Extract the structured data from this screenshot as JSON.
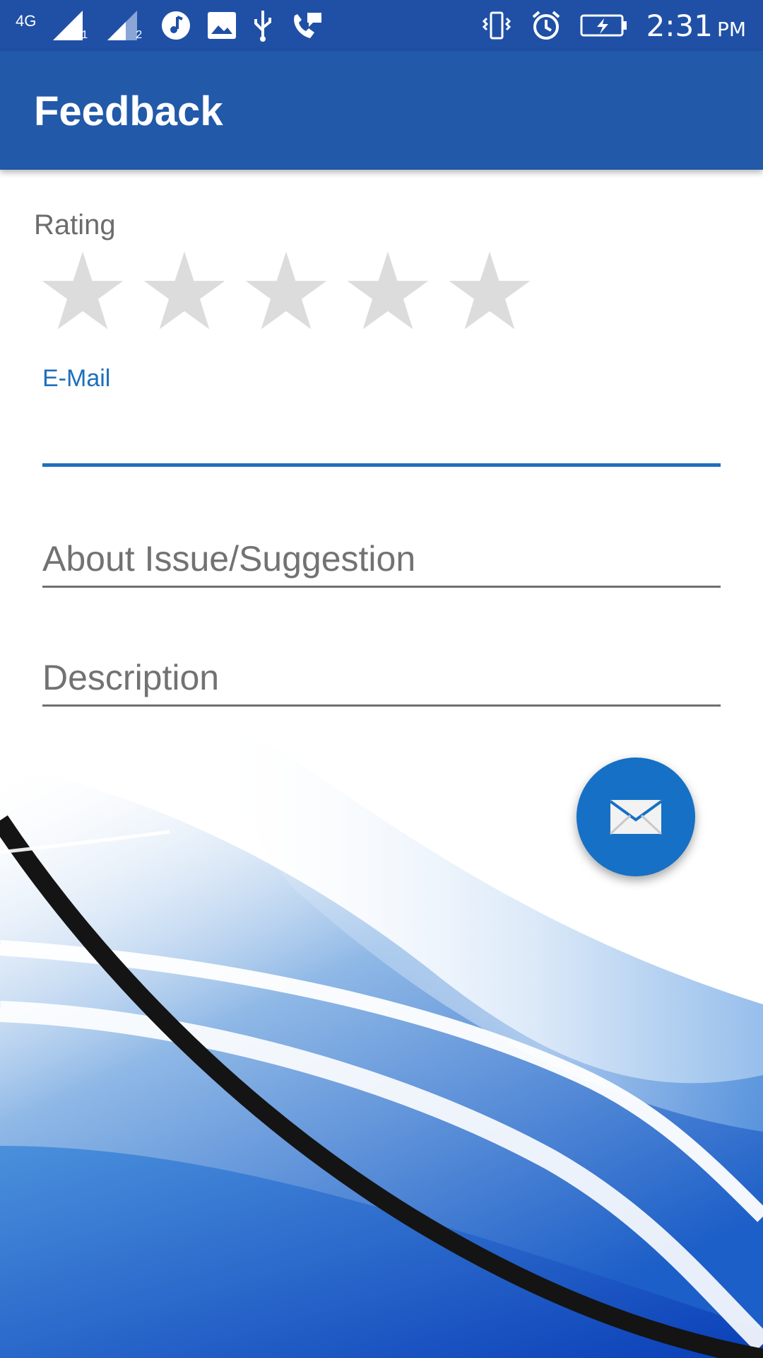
{
  "status_bar": {
    "network_type": "4G",
    "sim1_label": "1",
    "sim2_label": "2",
    "time": "2:31",
    "ampm": "PM",
    "icons": [
      "signal-icon",
      "music-icon",
      "image-icon",
      "usb-icon",
      "call-icon",
      "vibrate-icon",
      "alarm-icon",
      "battery-charging-icon"
    ]
  },
  "app_bar": {
    "title": "Feedback"
  },
  "form": {
    "rating": {
      "label": "Rating",
      "max": 5,
      "value": 0
    },
    "email": {
      "label": "E-Mail",
      "value": ""
    },
    "about": {
      "placeholder": "About Issue/Suggestion",
      "value": ""
    },
    "description": {
      "placeholder": "Description",
      "value": ""
    }
  },
  "fab": {
    "icon": "mail-icon"
  },
  "colors": {
    "status_bar": "#1f50a6",
    "app_bar": "#2259a9",
    "accent": "#1d6fbe",
    "fab": "#1670c5",
    "star_empty": "#dcdcdc"
  }
}
